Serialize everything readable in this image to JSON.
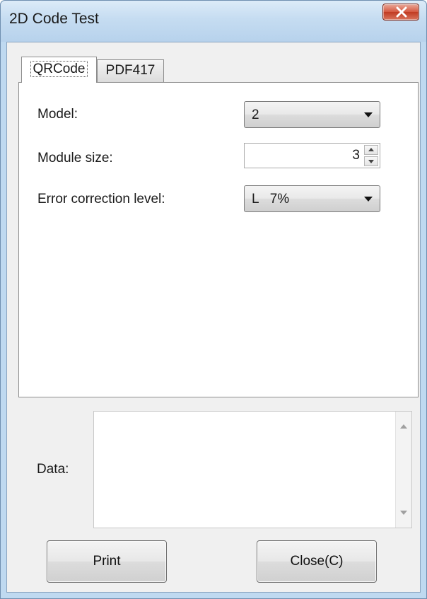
{
  "window": {
    "title": "2D Code Test"
  },
  "tabs": [
    {
      "label": "QRCode",
      "selected": true
    },
    {
      "label": "PDF417",
      "selected": false
    }
  ],
  "qrcode": {
    "model_label": "Model:",
    "model_value": "2",
    "module_size_label": "Module size:",
    "module_size_value": "3",
    "error_label": "Error correction level:",
    "error_value": "L   7%"
  },
  "data": {
    "label": "Data:",
    "value": ""
  },
  "buttons": {
    "print": "Print",
    "close": "Close(C)"
  },
  "icons": {
    "title_close": "close-x-icon",
    "combo_arrow": "chevron-down-icon",
    "spin_up": "spin-up-icon",
    "spin_down": "spin-down-icon",
    "scroll_up": "scroll-up-icon",
    "scroll_down": "scroll-down-icon"
  },
  "colors": {
    "frame": "#bfd9f0",
    "close_button": "#c94a32",
    "client_bg": "#f0f0f0"
  }
}
